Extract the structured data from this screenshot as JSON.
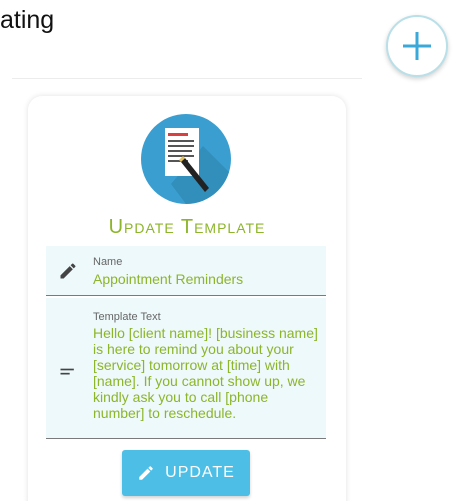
{
  "header": {
    "title_fragment": "ating",
    "add_button_icon": "plus-icon"
  },
  "card": {
    "icon": "document-edit-icon",
    "title": "Update Template",
    "fields": [
      {
        "icon": "pencil-icon",
        "label": "Name",
        "value": "Appointment Reminders"
      },
      {
        "icon": "text-lines-icon",
        "label": "Template Text",
        "value": "Hello [client name]! [business name] is here to remind you about your [service] tomorrow at [time] with [name]. If you cannot show up, we kindly ask you to call [phone number] to reschedule."
      }
    ],
    "button": {
      "icon": "pencil-icon",
      "label": "UPDATE"
    }
  },
  "colors": {
    "accent_green": "#8cb52a",
    "button_blue": "#4dbfe6",
    "field_bg": "#eef9fb",
    "icon_circle": "#3a9fd0"
  }
}
